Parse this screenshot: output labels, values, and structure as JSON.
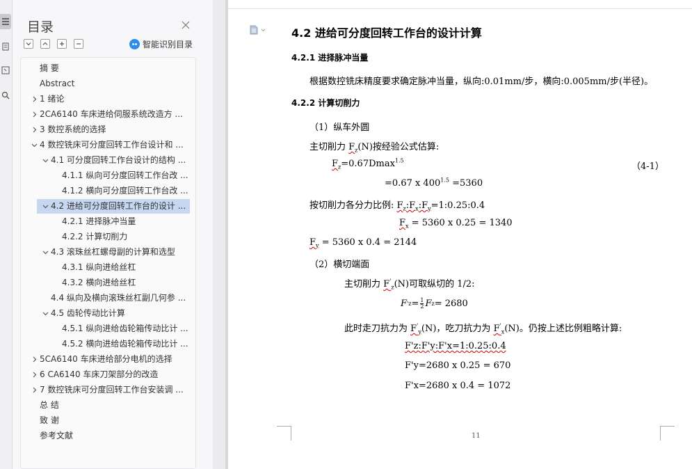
{
  "toc": {
    "title": "目录",
    "smart_label": "智能识别目录",
    "items": [
      {
        "label": "摘    要",
        "level": 0,
        "arrow": "none"
      },
      {
        "label": "Abstract",
        "level": 0,
        "arrow": "none"
      },
      {
        "label": "1 绪论",
        "level": 0,
        "arrow": "right"
      },
      {
        "label": "2CA6140 车床进给伺服系统改造方 ...",
        "level": 0,
        "arrow": "right"
      },
      {
        "label": "3 数控系统的选择",
        "level": 0,
        "arrow": "right"
      },
      {
        "label": "4 数控铣床可分度回转工作台设计和 ...",
        "level": 0,
        "arrow": "down"
      },
      {
        "label": "4.1 可分度回转工作台设计的结构 ...",
        "level": 1,
        "arrow": "down"
      },
      {
        "label": "4.1.1 纵向可分度回转工作台改 ...",
        "level": 2,
        "arrow": "none"
      },
      {
        "label": "4.1.2 横向可分度回转工作台改 ...",
        "level": 2,
        "arrow": "none"
      },
      {
        "label": "4.2 进给可分度回转工作台的设计 ...",
        "level": 1,
        "arrow": "down",
        "selected": true
      },
      {
        "label": "4.2.1 进择脉冲当量",
        "level": 2,
        "arrow": "none"
      },
      {
        "label": "4.2.2 计算切削力",
        "level": 2,
        "arrow": "none"
      },
      {
        "label": "4.3 滚珠丝杠螺母副的计算和选型",
        "level": 1,
        "arrow": "down"
      },
      {
        "label": "4.3.1 纵向进给丝杠",
        "level": 2,
        "arrow": "none"
      },
      {
        "label": "4.3.2 横向进给丝杠",
        "level": 2,
        "arrow": "none"
      },
      {
        "label": "4.4 纵向及横向滚珠丝杠副几何参 ...",
        "level": 1,
        "arrow": "none"
      },
      {
        "label": "4.5 齿轮传动比计算",
        "level": 1,
        "arrow": "down"
      },
      {
        "label": "4.5.1 纵向进给齿轮箱传动比计 ...",
        "level": 2,
        "arrow": "none"
      },
      {
        "label": "4.5.2 横向进给齿轮箱传动比计 ...",
        "level": 2,
        "arrow": "none"
      },
      {
        "label": "5CA6140 车床进给部分电机的选择",
        "level": 0,
        "arrow": "right"
      },
      {
        "label": "6 CA6140 车床刀架部分的改造",
        "level": 0,
        "arrow": "right"
      },
      {
        "label": "7 数控铣床可分度回转工作台安装调 ...",
        "level": 0,
        "arrow": "right"
      },
      {
        "label": "总    结",
        "level": 0,
        "arrow": "none"
      },
      {
        "label": "致    谢",
        "level": 0,
        "arrow": "none"
      },
      {
        "label": "参考文献",
        "level": 0,
        "arrow": "none"
      }
    ]
  },
  "doc": {
    "h_4_2": "4.2 进给可分度回转工作台的设计计算",
    "h_4_2_1": "4.2.1 进择脉冲当量",
    "p_pulse": "根据数控铣床精度要求确定脉冲当量，纵向:0.01mm/步，横向:0.005mm/步(半径)。",
    "h_4_2_2": "4.2.2 计算切削力",
    "sub1": "（1）纵车外圆",
    "main_force_a": "主切削力 ",
    "main_force_fz": "F",
    "main_force_fz_sub": "z",
    "main_force_b": "(N)按经验公式估算:",
    "eq1_a": "F",
    "eq1_sub": "z",
    "eq1_b": "=0.67Dmax",
    "eq1_sup": "1.5",
    "eq1_num": "（4-1）",
    "eq2_a": "=0.67 x 400",
    "eq2_sup": "1.5",
    "eq2_b": " =5360",
    "ratio_prefix": "按切削力各分力比例: ",
    "ratio_a": "F",
    "ratio_sub_z": "z",
    "ratio_colon1": ":F",
    "ratio_sub_x": "x",
    "ratio_colon2": ":F",
    "ratio_sub_y": "y",
    "ratio_b": "=1:0.25:0.4",
    "fx_a": "F",
    "fx_sub": "x",
    "fx_b": " = 5360  x 0.25 = 1340",
    "fy_a": "F",
    "fy_sub": "y",
    "fy_b": " = 5360 x 0.4 = 2144",
    "sub2": "（2）横切端面",
    "m2_a": "主切削力 ",
    "m2_f": "F",
    "m2_sup": "'",
    "m2_sub": "z",
    "m2_b": "(N)可取纵切的 1/2:",
    "frac_lhs": "F",
    "frac_lhs_sup": "'",
    "frac_lhs_sub": "z",
    "frac_eq": " = ",
    "frac_num": "1",
    "frac_den": "2",
    "frac_rhs": "F",
    "frac_rhs_sub": "z",
    "frac_val": " = 2680",
    "p_walk_a": "此时走刀抗力为 ",
    "p_walk_f1": "F",
    "p_walk_f1_sup": "'",
    "p_walk_f1_sub": "y",
    "p_walk_b": "(N)，吃刀抗力为 ",
    "p_walk_f2": "F",
    "p_walk_f2_sup": "'",
    "p_walk_f2_sub": "x",
    "p_walk_c": "(N)。仍按上述比例粗略计算:",
    "r2": "F'z:F'y:F'x=1:0.25:0.4",
    "r3": "F'y=2680  x 0.25 = 670",
    "r4": "F'x=2680  x 0.4 = 1072",
    "page_number": "11"
  }
}
